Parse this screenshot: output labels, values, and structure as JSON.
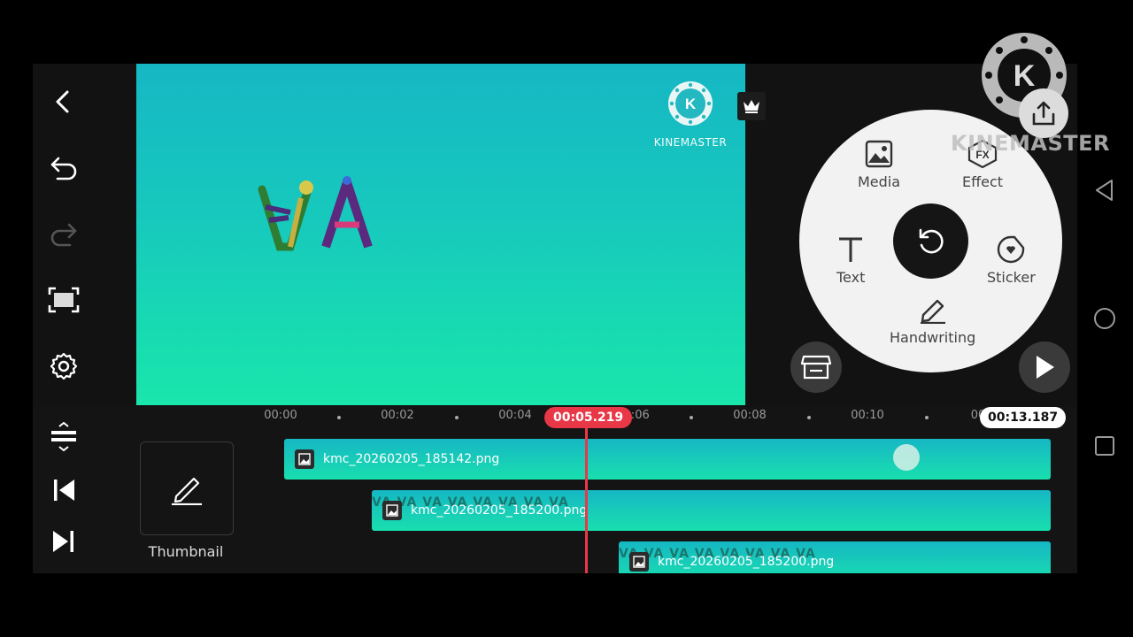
{
  "preview": {
    "watermark_text": "KINEMASTER",
    "watermark_logo_letter": "K",
    "title_logo_text": "VA"
  },
  "wheel": {
    "media_label": "Media",
    "effect_label": "Effect",
    "effect_icon_text": "FX",
    "text_label": "Text",
    "sticker_label": "Sticker",
    "handwriting_label": "Handwriting"
  },
  "corner_logo": {
    "letter": "K",
    "text": "KINEMASTER"
  },
  "timeline": {
    "ticks": [
      "00:00",
      "00:02",
      "00:04",
      "00:06",
      "00:08",
      "00:10",
      "00"
    ],
    "current_time": "00:05.219",
    "end_time": "00:13.187",
    "thumbnail_label": "Thumbnail",
    "clips": [
      {
        "name": "kmc_20260205_185142.png"
      },
      {
        "name": "kmc_20260205_185200.png"
      },
      {
        "name": "kmc_20260205_185200.png"
      }
    ],
    "clip_pattern_text": "VA VA VA VA VA VA VA VA"
  },
  "colors": {
    "accent": "#e83848",
    "preview_top": "#16b7c4",
    "preview_bottom": "#19e6ab",
    "wheel_bg": "#f2f2f2"
  }
}
